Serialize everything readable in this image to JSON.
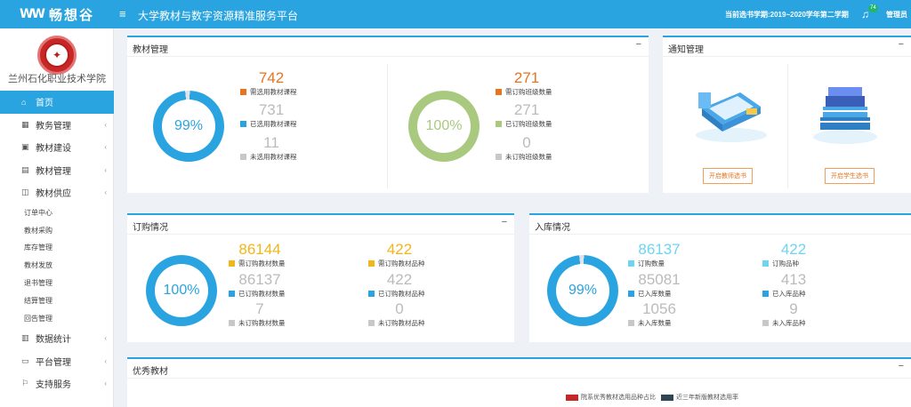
{
  "header": {
    "brand": "畅想谷",
    "platform_title": "大学教材与数字资源精准服务平台",
    "term_info": "当前选书学期:2019~2020学年第二学期",
    "notify_count": "74",
    "admin_label": "管理员"
  },
  "sidebar": {
    "school_name": "兰州石化职业技术学院",
    "items": [
      {
        "label": "首页",
        "icon": "home-icon"
      },
      {
        "label": "教务管理",
        "icon": "grid-icon"
      },
      {
        "label": "教材建设",
        "icon": "book-icon"
      },
      {
        "label": "教材管理",
        "icon": "list-icon"
      },
      {
        "label": "教材供应",
        "icon": "box-icon"
      }
    ],
    "sub_items": [
      "订单中心",
      "教材采购",
      "库存管理",
      "教材发放",
      "退书管理",
      "结算管理",
      "回告管理"
    ],
    "bottom_items": [
      {
        "label": "数据统计",
        "icon": "chart-icon"
      },
      {
        "label": "平台管理",
        "icon": "monitor-icon"
      },
      {
        "label": "支持服务",
        "icon": "flag-icon"
      }
    ]
  },
  "textbook_mgmt": {
    "title": "教材管理",
    "left": {
      "percent": "99%",
      "percent_value": 99,
      "stats": [
        {
          "value": "742",
          "label": "需选用教材课程",
          "color": "#e8741f"
        },
        {
          "value": "731",
          "label": "已选用教材课程",
          "color": "#2aa4e0"
        },
        {
          "value": "11",
          "label": "未选用教材课程",
          "color": "#c8c8c8"
        }
      ]
    },
    "right": {
      "percent": "100%",
      "percent_value": 100,
      "stats": [
        {
          "value": "271",
          "label": "需订购班级数量",
          "color": "#e8741f"
        },
        {
          "value": "271",
          "label": "已订购班级数量",
          "color": "#a9c97f"
        },
        {
          "value": "0",
          "label": "未订购班级数量",
          "color": "#c8c8c8"
        }
      ]
    }
  },
  "notice_mgmt": {
    "title": "通知管理",
    "btn_teacher": "开启教师选书",
    "btn_student": "开启学生选书"
  },
  "order_status": {
    "title": "订购情况",
    "percent": "100%",
    "percent_value": 100,
    "col1": [
      {
        "value": "86144",
        "label": "需订购教材数量",
        "color": "#f2b619"
      },
      {
        "value": "86137",
        "label": "已订购教材数量",
        "color": "#2aa4e0"
      },
      {
        "value": "7",
        "label": "未订购教材数量",
        "color": "#c8c8c8"
      }
    ],
    "col2": [
      {
        "value": "422",
        "label": "需订购教材品种",
        "color": "#f2b619"
      },
      {
        "value": "422",
        "label": "已订购教材品种",
        "color": "#2aa4e0"
      },
      {
        "value": "0",
        "label": "未订购教材品种",
        "color": "#c8c8c8"
      }
    ]
  },
  "stock_in": {
    "title": "入库情况",
    "percent": "99%",
    "percent_value": 99,
    "col1": [
      {
        "value": "86137",
        "label": "订购数量",
        "color": "#6fd4f0"
      },
      {
        "value": "85081",
        "label": "已入库数量",
        "color": "#2aa4e0"
      },
      {
        "value": "1056",
        "label": "未入库数量",
        "color": "#c8c8c8"
      }
    ],
    "col2": [
      {
        "value": "422",
        "label": "订购品种",
        "color": "#6fd4f0"
      },
      {
        "value": "413",
        "label": "已入库品种",
        "color": "#2aa4e0"
      },
      {
        "value": "9",
        "label": "未入库品种",
        "color": "#c8c8c8"
      }
    ]
  },
  "excellent": {
    "title": "优秀教材",
    "legend": [
      {
        "label": "院系优秀教材选用品种占比",
        "color": "#c62828"
      },
      {
        "label": "近三年新版教材选用率",
        "color": "#2f4554"
      }
    ]
  },
  "colors": {
    "accent": "#2aa4e0",
    "green": "#a9c97f",
    "orange": "#e8741f",
    "yellow": "#f2b619",
    "cyan": "#6fd4f0"
  }
}
